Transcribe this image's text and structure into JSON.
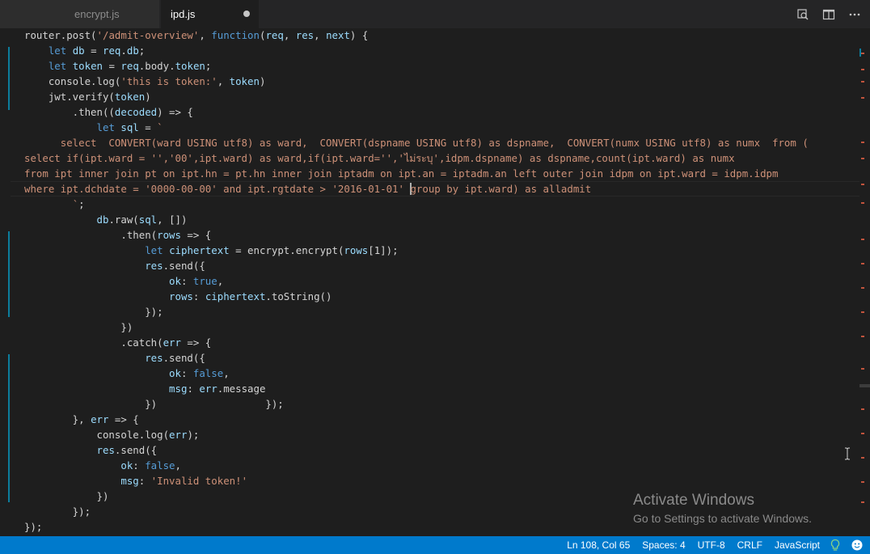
{
  "tabs": [
    {
      "label": "encrypt.js",
      "active": false,
      "dirty": false
    },
    {
      "label": "ipd.js",
      "active": true,
      "dirty": true
    }
  ],
  "tab_actions": [
    "open-changes-icon",
    "split-editor-icon",
    "more-actions-icon"
  ],
  "code": {
    "lines": [
      "router.post('/admit-overview', function(req, res, next) {",
      "    let db = req.db;",
      "    let token = req.body.token;",
      "    console.log('this is token:', token)",
      "    jwt.verify(token)",
      "        .then((decoded) => {",
      "            let sql = `",
      "      select  CONVERT(ward USING utf8) as ward,  CONVERT(dspname USING utf8) as dspname,  CONVERT(numx USING utf8) as numx  from (",
      "select if(ipt.ward = '','00',ipt.ward) as ward,if(ipt.ward='','ไม่ระบุ',idpm.dspname) as dspname,count(ipt.ward) as numx",
      "from ipt inner join pt on ipt.hn = pt.hn inner join iptadm on ipt.an = iptadm.an left outer join idpm on ipt.ward = idpm.idpm",
      "where ipt.dchdate = '0000-00-00' and ipt.rgtdate > '2016-01-01' group by ipt.ward) as alladmit",
      "        `;",
      "            db.raw(sql, [])",
      "                .then(rows => {",
      "                    let ciphertext = encrypt.encrypt(rows[1]);",
      "                    res.send({",
      "                        ok: true,",
      "                        rows: ciphertext.toString()",
      "                    });",
      "                })",
      "                .catch(err => {",
      "                    res.send({",
      "                        ok: false,",
      "                        msg: err.message",
      "                    })                  });",
      "        }, err => {",
      "            console.log(err);",
      "            res.send({",
      "                ok: false,",
      "                msg: 'Invalid token!'",
      "            })",
      "        });",
      "});"
    ]
  },
  "watermark": {
    "title": "Activate Windows",
    "subtitle": "Go to Settings to activate Windows."
  },
  "status_bar": {
    "position": "Ln 108, Col 65",
    "indent": "Spaces: 4",
    "encoding": "UTF-8",
    "eol": "CRLF",
    "language": "JavaScript"
  },
  "colors": {
    "status_bar": "#007acc",
    "editor_bg": "#1e1e1e",
    "keyword": "#569cd6",
    "string": "#ce9178"
  }
}
